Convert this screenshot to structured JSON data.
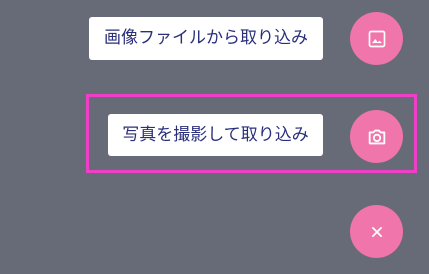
{
  "colors": {
    "background": "#676b77",
    "fab": "#ef75aa",
    "highlight": "#ef3fc7",
    "label_text": "#2a2f7a",
    "label_bg": "#ffffff"
  },
  "menu": {
    "items": [
      {
        "label": "画像ファイルから取り込み",
        "icon": "image-icon"
      },
      {
        "label": "写真を撮影して取り込み",
        "icon": "camera-icon"
      }
    ],
    "close_icon": "close-icon"
  }
}
